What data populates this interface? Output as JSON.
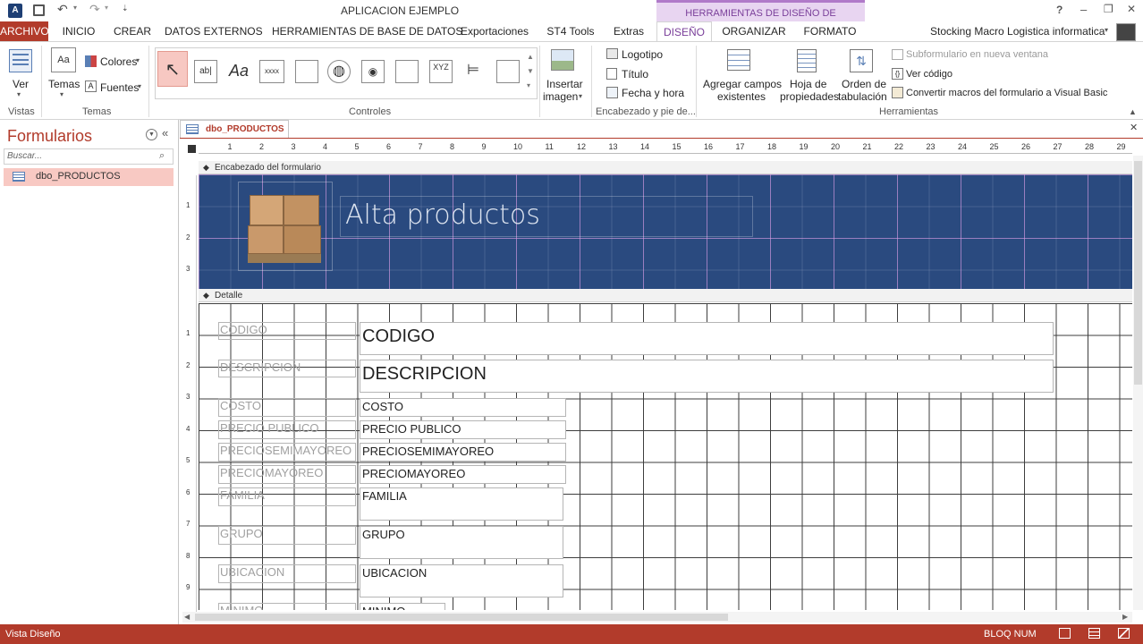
{
  "titlebar": {
    "title": "APLICACION EJEMPLO",
    "context_title": "HERRAMIENTAS DE DISEÑO DE FORMULARIO",
    "help": "?",
    "minimize": "–",
    "restore": "❐",
    "close": "✕"
  },
  "tabs": [
    "ARCHIVO",
    "INICIO",
    "CREAR",
    "DATOS EXTERNOS",
    "HERRAMIENTAS DE BASE DE DATOS",
    "Exportaciones",
    "ST4 Tools",
    "Extras",
    "DISEÑO",
    "ORGANIZAR",
    "FORMATO"
  ],
  "user": {
    "name": "Stocking Macro Logistica informatica"
  },
  "ribbon": {
    "vistas": {
      "ver": "Ver",
      "group": "Vistas"
    },
    "temas": {
      "temas": "Temas",
      "colores": "Colores",
      "fuentes": "Fuentes",
      "group": "Temas"
    },
    "controles": {
      "group": "Controles",
      "textbox": "ab|",
      "label": "Aa",
      "button": "xxxx",
      "xyz": "XYZ"
    },
    "insertar": {
      "line1": "Insertar",
      "line2": "imagen"
    },
    "encabezado": {
      "logotipo": "Logotipo",
      "titulo": "Título",
      "fecha": "Fecha y hora",
      "group": "Encabezado y pie de..."
    },
    "herramientas": {
      "agregar1": "Agregar campos",
      "agregar2": "existentes",
      "hoja1": "Hoja de",
      "hoja2": "propiedades",
      "orden1": "Orden de",
      "orden2": "tabulación",
      "subform": "Subformulario en nueva ventana",
      "vercodigo": "Ver código",
      "convertir": "Convertir macros del formulario a Visual Basic",
      "group": "Herramientas"
    }
  },
  "navpane": {
    "title": "Formularios",
    "search_placeholder": "Buscar...",
    "items": [
      {
        "label": "dbo_PRODUCTOS"
      }
    ]
  },
  "document": {
    "tab": "dbo_PRODUCTOS",
    "ruler_numbers": [
      "1",
      "2",
      "3",
      "4",
      "5",
      "6",
      "7",
      "8",
      "9",
      "10",
      "11",
      "12",
      "13",
      "14",
      "15",
      "16",
      "17",
      "18",
      "19",
      "20",
      "21",
      "22",
      "23",
      "24",
      "25",
      "26",
      "27",
      "28",
      "29"
    ],
    "vruler_header": [
      "1",
      "2",
      "3"
    ],
    "vruler_detail": [
      "1",
      "2",
      "3",
      "4",
      "5",
      "6",
      "7",
      "8",
      "9"
    ],
    "header_section": "Encabezado del formulario",
    "detail_section": "Detalle",
    "form_title": "Alta productos",
    "header_bg": "#2a4a7f",
    "fields": [
      {
        "label": "CODIGO",
        "value": "CODIGO"
      },
      {
        "label": "DESCRIPCION",
        "value": "DESCRIPCION"
      },
      {
        "label": "COSTO",
        "value": "COSTO"
      },
      {
        "label": "PRECIO PUBLICO",
        "value": "PRECIO PUBLICO"
      },
      {
        "label": "PRECIOSEMIMAYOREO",
        "value": "PRECIOSEMIMAYOREO"
      },
      {
        "label": "PRECIOMAYOREO",
        "value": "PRECIOMAYOREO"
      },
      {
        "label": "FAMILIA",
        "value": "FAMILIA"
      },
      {
        "label": "GRUPO",
        "value": "GRUPO"
      },
      {
        "label": "UBICACION",
        "value": "UBICACION"
      },
      {
        "label": "MINIMO",
        "value": "MINIMO"
      }
    ]
  },
  "status": {
    "view": "Vista Diseño",
    "numlock": "BLOQ NUM"
  },
  "colors": {
    "accent": "#b23b2b",
    "context_tab": "#c9a0d9",
    "context_text": "#7a3f9a"
  }
}
